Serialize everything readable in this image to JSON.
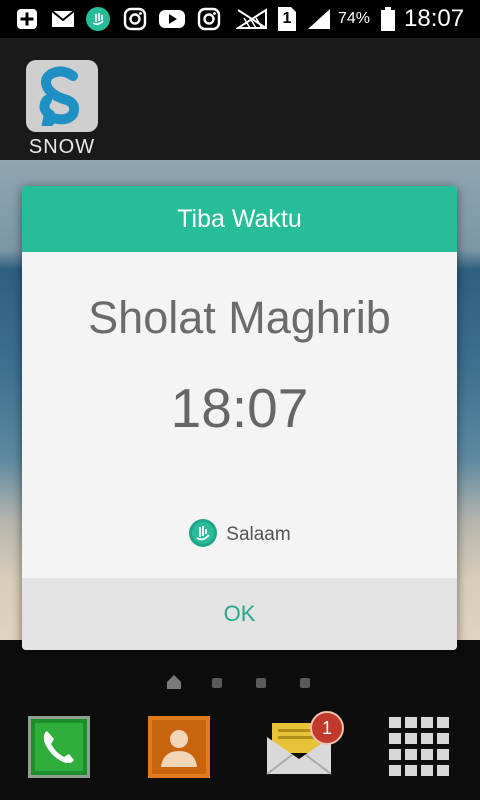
{
  "status_bar": {
    "battery_percent": "74%",
    "time": "18:07",
    "sim_label": "1",
    "icons": [
      "add-icon",
      "mail-icon",
      "salaam-notification-icon",
      "instagram-icon",
      "youtube-icon",
      "instagram-icon",
      "signal-blocked-icon",
      "sim-icon",
      "signal-strength-icon",
      "battery-icon"
    ]
  },
  "home": {
    "app_label": "SNOW",
    "accent_color": "#26bd98"
  },
  "dialog": {
    "title": "Tiba Waktu",
    "prayer": "Sholat Maghrib",
    "time": "18:07",
    "app_name": "Salaam",
    "ok_label": "OK"
  },
  "dock": {
    "messages_badge": "1",
    "items": [
      "phone-icon",
      "contacts-icon",
      "messages-icon",
      "apps-grid-icon"
    ]
  }
}
